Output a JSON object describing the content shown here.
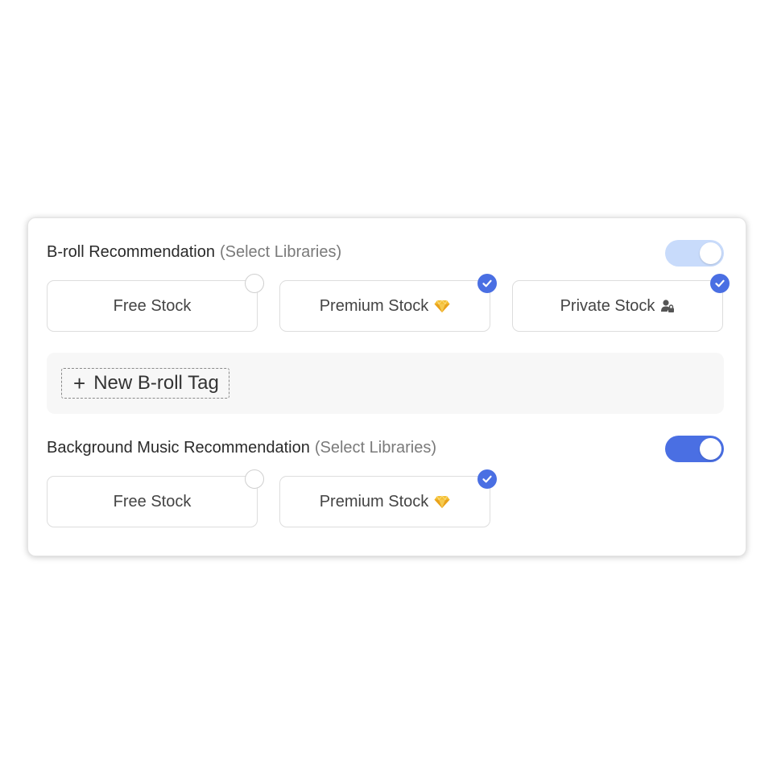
{
  "colors": {
    "accent": "#4a6fe3",
    "toggle_light": "#c8dbfb",
    "card_border": "#dddddd",
    "tag_area_bg": "#f7f7f7",
    "diamond": "#f2b62c"
  },
  "broll": {
    "title": "B-roll Recommendation",
    "hint": "(Select Libraries)",
    "toggle_on": true,
    "libraries": [
      {
        "label": "Free Stock",
        "selected": false,
        "icon": "none"
      },
      {
        "label": "Premium Stock",
        "selected": true,
        "icon": "diamond-icon"
      },
      {
        "label": "Private Stock",
        "selected": true,
        "icon": "private-user-icon"
      }
    ],
    "new_tag_label": "New B-roll Tag"
  },
  "music": {
    "title": "Background Music Recommendation",
    "hint": "(Select Libraries)",
    "toggle_on": true,
    "libraries": [
      {
        "label": "Free Stock",
        "selected": false,
        "icon": "none"
      },
      {
        "label": "Premium Stock",
        "selected": true,
        "icon": "diamond-icon"
      }
    ]
  }
}
